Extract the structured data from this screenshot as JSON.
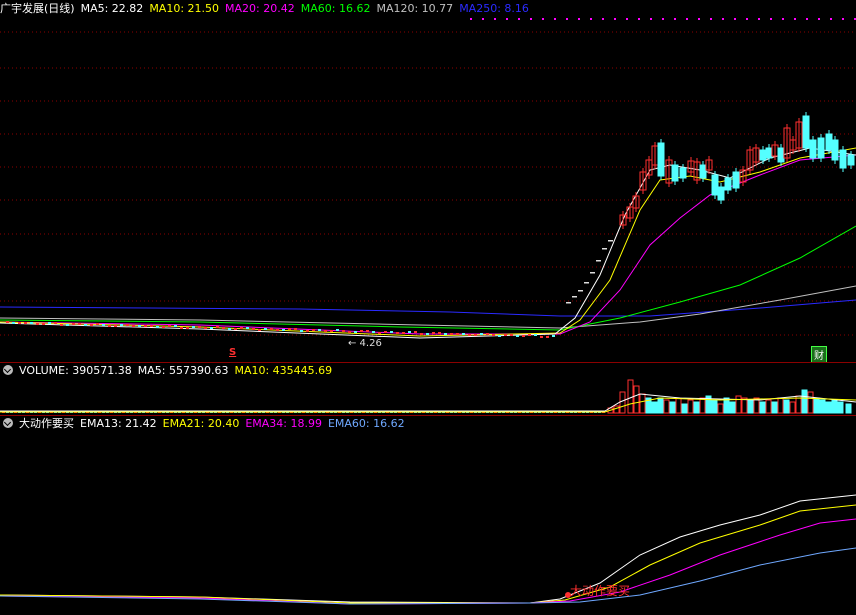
{
  "price_pane": {
    "stock_name": "广宇发展(日线)",
    "ma_labels": [
      {
        "text": "MA5: 22.82",
        "color": "#ffffff"
      },
      {
        "text": "MA10: 21.50",
        "color": "#ffff00"
      },
      {
        "text": "MA20: 20.42",
        "color": "#ff00ff"
      },
      {
        "text": "MA60: 16.62",
        "color": "#00ff00"
      },
      {
        "text": "MA120: 10.77",
        "color": "#c0c0c0"
      },
      {
        "text": "MA250: 8.16",
        "color": "#0000ff"
      }
    ],
    "low_label": "← 4.26",
    "signal_mark": "S",
    "finance_badge": "财"
  },
  "volume_pane": {
    "labels": [
      {
        "text": "VOLUME: 390571.38",
        "color": "#ffffff"
      },
      {
        "text": "MA5: 557390.63",
        "color": "#ffffff"
      },
      {
        "text": "MA10: 435445.69",
        "color": "#ffff00"
      }
    ]
  },
  "indicator_pane": {
    "name": "大动作要买",
    "labels": [
      {
        "text": "EMA13: 21.42",
        "color": "#ffffff"
      },
      {
        "text": "EMA21: 20.40",
        "color": "#ffff00"
      },
      {
        "text": "EMA34: 18.99",
        "color": "#ff00ff"
      },
      {
        "text": "EMA60: 16.62",
        "color": "#6fa8ff"
      }
    ],
    "buy_signal": "大动作要买"
  },
  "colors": {
    "up": "#ff3030",
    "down": "#54ffff",
    "grid": "#8b0000"
  }
}
